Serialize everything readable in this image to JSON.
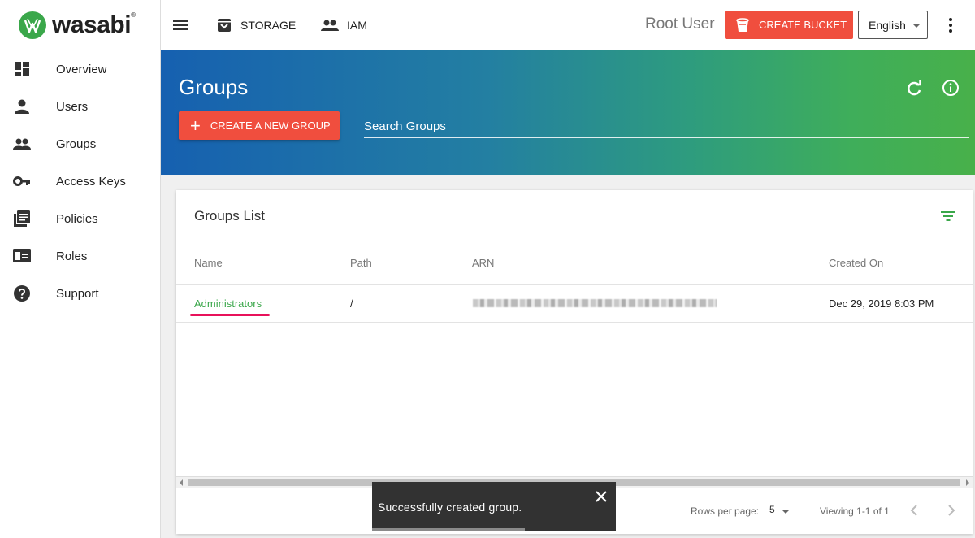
{
  "brand": {
    "name": "wasabi",
    "tm": "®",
    "colors": {
      "green": "#3aa74a",
      "accent": "#f04e3e",
      "snackbar": "#323232"
    }
  },
  "topbar": {
    "nav": [
      {
        "label": "STORAGE",
        "icon": "archive-icon"
      },
      {
        "label": "IAM",
        "icon": "people-icon"
      }
    ],
    "user": "Root User",
    "create_bucket_label": "CREATE BUCKET",
    "language": "English"
  },
  "sidebar": {
    "items": [
      {
        "label": "Overview",
        "icon": "dashboard-icon"
      },
      {
        "label": "Users",
        "icon": "person-icon"
      },
      {
        "label": "Groups",
        "icon": "people-icon"
      },
      {
        "label": "Access Keys",
        "icon": "key-icon"
      },
      {
        "label": "Policies",
        "icon": "library-icon"
      },
      {
        "label": "Roles",
        "icon": "badge-icon"
      },
      {
        "label": "Support",
        "icon": "help-icon"
      }
    ]
  },
  "hero": {
    "title": "Groups",
    "create_group_label": "CREATE A NEW GROUP",
    "search_placeholder": "Search Groups"
  },
  "card": {
    "title": "Groups List",
    "columns": [
      "Name",
      "Path",
      "ARN",
      "Created On"
    ],
    "rows": [
      {
        "name": "Administrators",
        "path": "/",
        "arn": "",
        "created_on": "Dec 29, 2019 8:03 PM"
      }
    ],
    "footer": {
      "rows_per_page_label": "Rows per page:",
      "rows_per_page": "5",
      "viewing": "Viewing 1-1 of 1"
    }
  },
  "snackbar": {
    "message": "Successfully created group."
  }
}
